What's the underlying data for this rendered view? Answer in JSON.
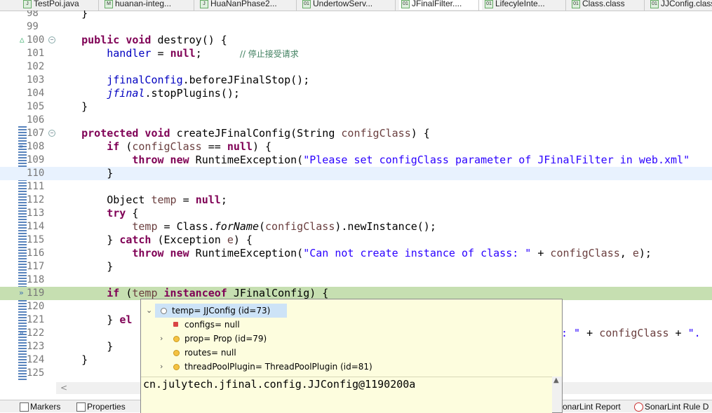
{
  "tabs": [
    {
      "label": "TestPoi.java"
    },
    {
      "label": "huanan-integ..."
    },
    {
      "label": "HuaNanPhase2..."
    },
    {
      "label": "UndertowServ..."
    },
    {
      "label": "JFinalFilter...."
    },
    {
      "label": "LifecyleInte..."
    },
    {
      "label": "Class.class"
    },
    {
      "label": "JJConfig.class"
    }
  ],
  "editor": {
    "line_numbers": [
      "98",
      "99",
      "100",
      "101",
      "102",
      "103",
      "104",
      "105",
      "106",
      "107",
      "108",
      "109",
      "110",
      "111",
      "112",
      "113",
      "114",
      "115",
      "116",
      "117",
      "118",
      "119",
      "120",
      "121",
      "122",
      "123",
      "124",
      "125"
    ],
    "tok": {
      "l98": "}",
      "l100a": "public void",
      "l100b": " destroy() {",
      "l101a": "handler",
      "l101b": " = ",
      "l101c": "null",
      "l101d": ";      ",
      "l101e": "// 停止接受请求",
      "l103a": "jfinalConfig",
      "l103b": ".beforeJFinalStop();",
      "l104a": "jfinal",
      "l104b": ".stopPlugins();",
      "l105": "}",
      "l107a": "protected void",
      "l107b": " createJFinalConfig(String ",
      "l107c": "configClass",
      "l107d": ") {",
      "l108a": "if",
      "l108b": " (",
      "l108c": "configClass",
      "l108d": " == ",
      "l108e": "null",
      "l108f": ") {",
      "l109a": "throw new",
      "l109b": " RuntimeException(",
      "l109c": "\"Please set configClass parameter of JFinalFilter in web.xml\"",
      "l110": "}",
      "l112a": "Object ",
      "l112b": "temp",
      "l112c": " = ",
      "l112d": "null",
      "l112e": ";",
      "l113a": "try",
      "l113b": " {",
      "l114a": "temp",
      "l114b": " = Class.",
      "l114c": "forName",
      "l114d": "(",
      "l114e": "configClass",
      "l114f": ").newInstance();",
      "l115a": "} ",
      "l115b": "catch",
      "l115c": " (Exception ",
      "l115d": "e",
      "l115e": ") {",
      "l116a": "throw new",
      "l116b": " RuntimeException(",
      "l116c": "\"Can not create instance of class: \"",
      "l116d": " + ",
      "l116e": "configClass",
      "l116f": ", ",
      "l116g": "e",
      "l116h": ");",
      "l117": "}",
      "l119a": "if",
      "l119b": " (",
      "l119c": "temp",
      "l119d": " ",
      "l119e": "instanceof",
      "l119f": " JFinalConfig) {",
      "l121a": "} ",
      "l121b": "el",
      "l122a": ": \"",
      "l122b": " + ",
      "l122c": "configClass",
      "l122d": " + ",
      "l122e": "\".",
      "l123": "}",
      "l124": "}"
    }
  },
  "debug_hover": {
    "root": {
      "label": "temp= JJConfig  (id=73)"
    },
    "children": [
      {
        "label": "configs= null"
      },
      {
        "label": "prop= Prop  (id=79)"
      },
      {
        "label": "routes= null"
      },
      {
        "label": "threadPoolPlugin= ThreadPoolPlugin  (id=81)"
      }
    ],
    "detail": "cn.julytech.jfinal.config.JJConfig@1190200a"
  },
  "bottom_tabs": [
    {
      "label": "Markers"
    },
    {
      "label": "Properties"
    },
    {
      "label": "onarLint Report"
    },
    {
      "label": "SonarLint Rule D"
    }
  ],
  "colors": {
    "keyword": "#7f0055",
    "field": "#0000c0",
    "string": "#2a00ff",
    "comment": "#3f7f5f",
    "current_line": "#e8f2fe",
    "debug_line": "#c6dfb1",
    "hover_bg": "#fdfdde"
  }
}
